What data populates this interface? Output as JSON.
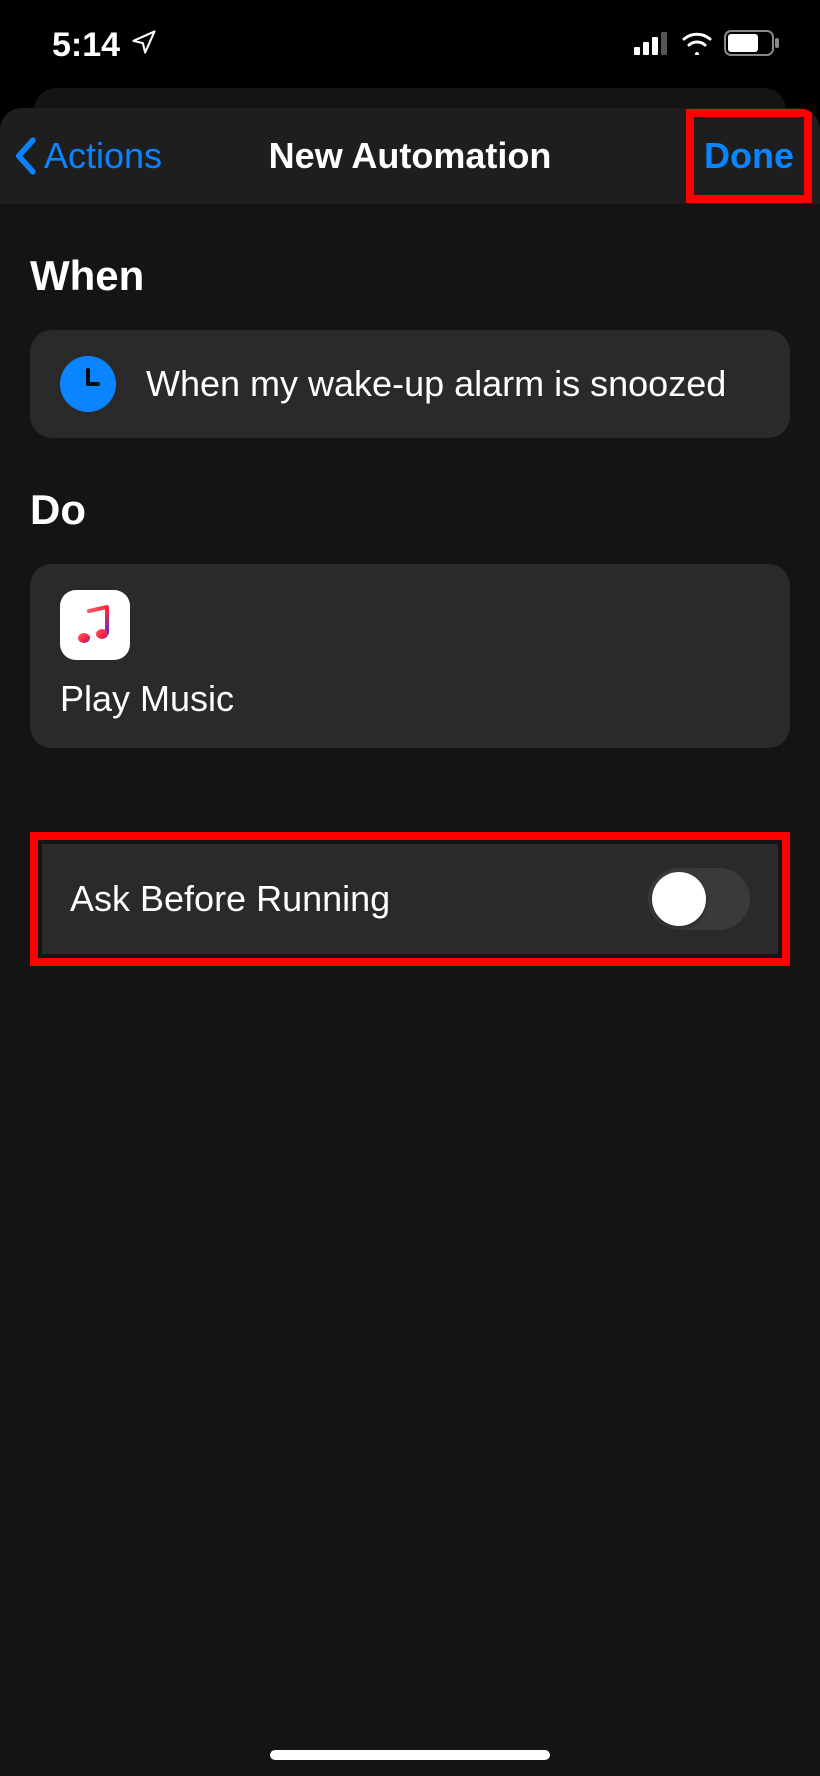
{
  "status": {
    "time": "5:14"
  },
  "nav": {
    "back_label": "Actions",
    "title": "New Automation",
    "done_label": "Done"
  },
  "sections": {
    "when_header": "When",
    "when_text": "When my wake-up alarm is snoozed",
    "do_header": "Do",
    "do_action": "Play Music"
  },
  "settings": {
    "ask_label": "Ask Before Running",
    "ask_value": false
  },
  "colors": {
    "accent": "#0a84ff",
    "card_bg": "#2a2a2a",
    "sheet_bg": "#141414",
    "highlight": "#ff0000"
  },
  "icons": {
    "location": "location-arrow-icon",
    "signal": "cellular-signal-icon",
    "wifi": "wifi-icon",
    "battery": "battery-icon",
    "clock": "clock-icon",
    "music": "music-note-icon",
    "back": "chevron-back-icon"
  }
}
